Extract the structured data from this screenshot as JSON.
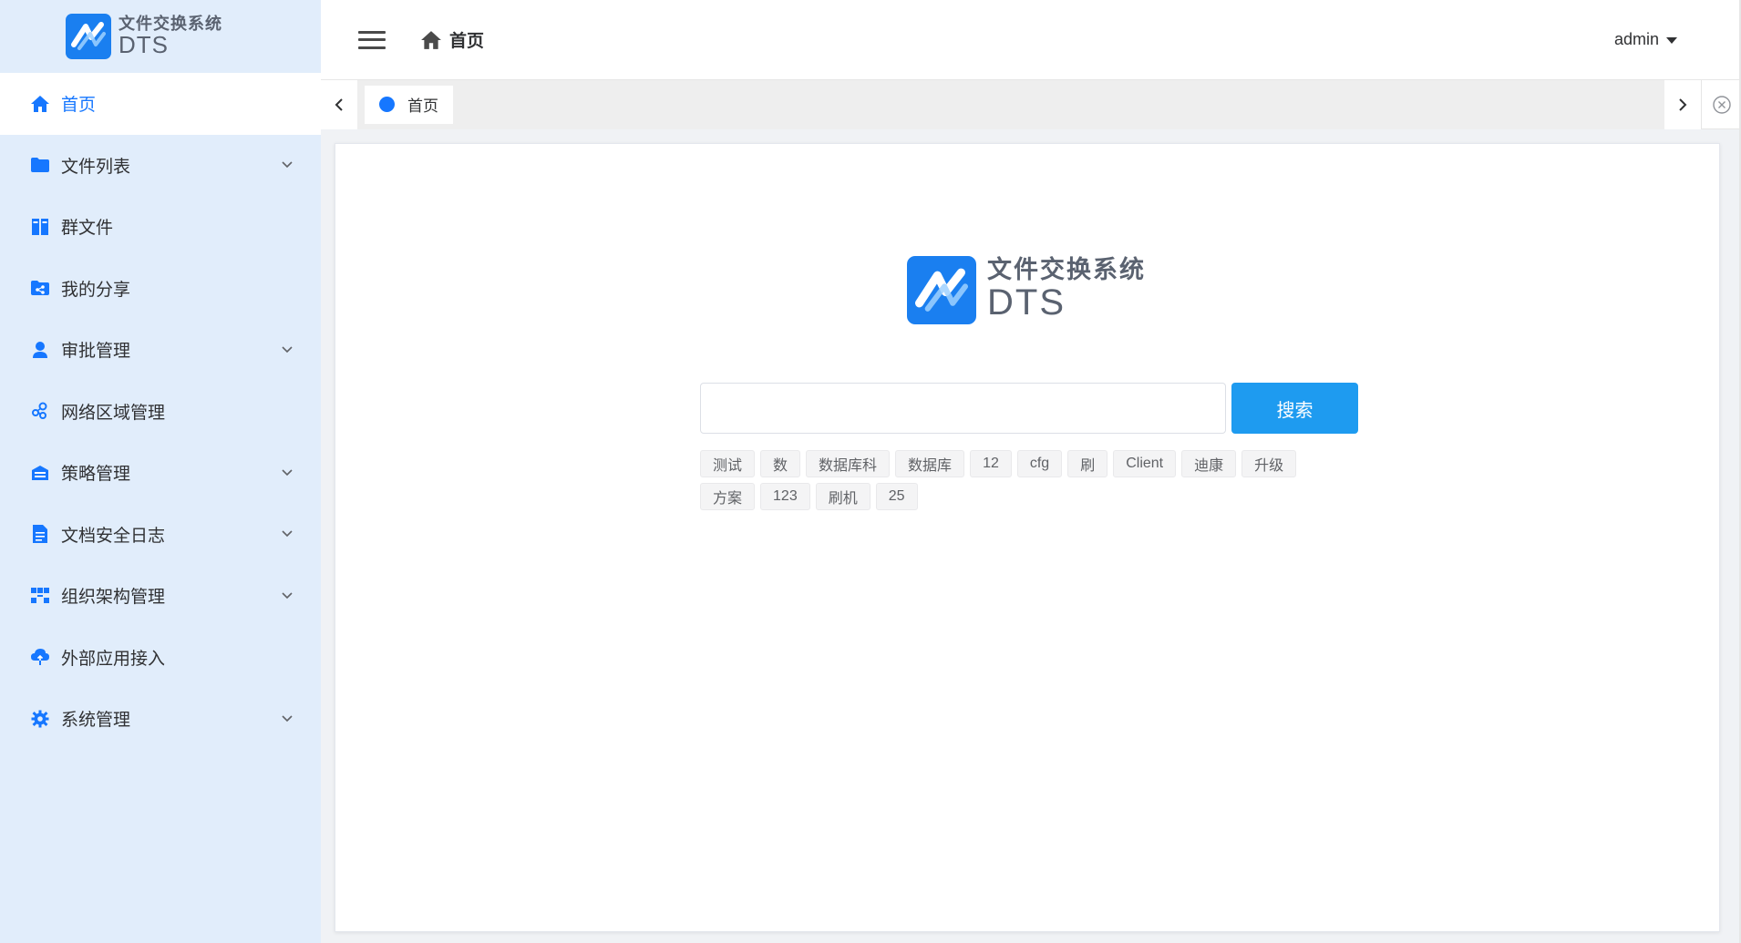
{
  "app": {
    "logo_cn": "文件交换系统",
    "logo_en": "DTS",
    "brand_color": "#1a7ff0",
    "accent_color": "#1677ff"
  },
  "sidebar": {
    "items": [
      {
        "label": "首页",
        "icon": "home-icon",
        "active": true,
        "expandable": false
      },
      {
        "label": "文件列表",
        "icon": "folder-icon",
        "active": false,
        "expandable": true
      },
      {
        "label": "群文件",
        "icon": "group-files-icon",
        "active": false,
        "expandable": false
      },
      {
        "label": "我的分享",
        "icon": "share-folder-icon",
        "active": false,
        "expandable": false
      },
      {
        "label": "审批管理",
        "icon": "user-icon",
        "active": false,
        "expandable": true
      },
      {
        "label": "网络区域管理",
        "icon": "network-icon",
        "active": false,
        "expandable": false
      },
      {
        "label": "策略管理",
        "icon": "policy-icon",
        "active": false,
        "expandable": true
      },
      {
        "label": "文档安全日志",
        "icon": "document-icon",
        "active": false,
        "expandable": true
      },
      {
        "label": "组织架构管理",
        "icon": "org-chart-icon",
        "active": false,
        "expandable": true
      },
      {
        "label": "外部应用接入",
        "icon": "cloud-upload-icon",
        "active": false,
        "expandable": false
      },
      {
        "label": "系统管理",
        "icon": "gear-icon",
        "active": false,
        "expandable": true
      }
    ]
  },
  "header": {
    "breadcrumb": "首页",
    "user": "admin"
  },
  "tabs": [
    {
      "label": "首页",
      "active": true
    }
  ],
  "main": {
    "logo_cn": "文件交换系统",
    "logo_en": "DTS",
    "search": {
      "value": "",
      "placeholder": "",
      "button_label": "搜索"
    },
    "tags": [
      "测试",
      "数",
      "数据库科",
      "数据库",
      "12",
      "cfg",
      "刷",
      "Client",
      "迪康",
      "升级",
      "方案",
      "123",
      "刷机",
      "25"
    ]
  }
}
